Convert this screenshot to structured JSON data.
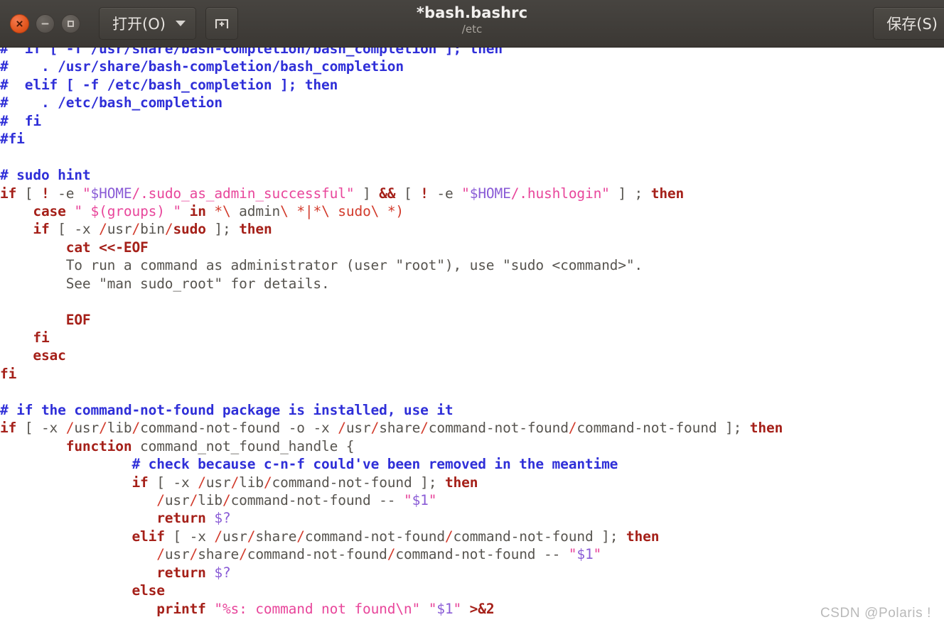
{
  "window": {
    "title": "*bash.bashrc",
    "subtitle": "/etc",
    "controls": {
      "close_label": "close-window",
      "minimize_label": "minimize-window",
      "maximize_label": "maximize-window"
    }
  },
  "toolbar": {
    "open_label": "打开(O)",
    "open_dropdown_label": "chevron-down-icon",
    "new_tab_label": "new-document-icon",
    "save_label": "保存(S)"
  },
  "watermark": "CSDN @Polaris !",
  "colors": {
    "titlebar_bg": "#413e3a",
    "close_button": "#e2571f",
    "editor_bg": "#ffffff",
    "comment": "#2f2fd8",
    "keyword": "#a52019",
    "string": "#e8469b",
    "variable": "#8a5cd6",
    "path_slash": "#d23b2c",
    "plain_text": "#57544f",
    "watermark": "#b9b9b9"
  },
  "editor": {
    "language": "sh",
    "filename": "bash.bashrc",
    "path": "/etc",
    "modified": true,
    "lines": [
      [
        {
          "t": "#  if [ -f /usr/share/bash-completion/bash_completion ]; then",
          "c": "cm"
        }
      ],
      [
        {
          "t": "#    . /usr/share/bash-completion/bash_completion",
          "c": "cm"
        }
      ],
      [
        {
          "t": "#  elif [ -f /etc/bash_completion ]; then",
          "c": "cm"
        }
      ],
      [
        {
          "t": "#    . /etc/bash_completion",
          "c": "cm"
        }
      ],
      [
        {
          "t": "#  fi",
          "c": "cm"
        }
      ],
      [
        {
          "t": "#fi",
          "c": "cm"
        }
      ],
      [
        {
          "t": "",
          "c": "pl"
        }
      ],
      [
        {
          "t": "# sudo hint",
          "c": "cm"
        }
      ],
      [
        {
          "t": "if",
          "c": "kw"
        },
        {
          "t": " [ ",
          "c": "pl"
        },
        {
          "t": "!",
          "c": "kw"
        },
        {
          "t": " -e ",
          "c": "pl"
        },
        {
          "t": "\"",
          "c": "st"
        },
        {
          "t": "$HOME",
          "c": "var"
        },
        {
          "t": "/.sudo_as_admin_successful\"",
          "c": "st"
        },
        {
          "t": " ] ",
          "c": "pl"
        },
        {
          "t": "&&",
          "c": "kw"
        },
        {
          "t": " [ ",
          "c": "pl"
        },
        {
          "t": "!",
          "c": "kw"
        },
        {
          "t": " -e ",
          "c": "pl"
        },
        {
          "t": "\"",
          "c": "st"
        },
        {
          "t": "$HOME",
          "c": "var"
        },
        {
          "t": "/.hushlogin\"",
          "c": "st"
        },
        {
          "t": " ] ; ",
          "c": "pl"
        },
        {
          "t": "then",
          "c": "kw"
        }
      ],
      [
        {
          "t": "    ",
          "c": "pl"
        },
        {
          "t": "case",
          "c": "kw"
        },
        {
          "t": " ",
          "c": "pl"
        },
        {
          "t": "\" ",
          "c": "st"
        },
        {
          "t": "$(groups)",
          "c": "st"
        },
        {
          "t": " \"",
          "c": "st"
        },
        {
          "t": " ",
          "c": "pl"
        },
        {
          "t": "in",
          "c": "kw"
        },
        {
          "t": " ",
          "c": "pl"
        },
        {
          "t": "*\\",
          "c": "sl"
        },
        {
          "t": " admin",
          "c": "pl"
        },
        {
          "t": "\\",
          "c": "sl"
        },
        {
          "t": " ",
          "c": "pl"
        },
        {
          "t": "*|*\\",
          "c": "sl"
        },
        {
          "t": " ",
          "c": "pl"
        },
        {
          "t": "sudo\\",
          "c": "sl"
        },
        {
          "t": " ",
          "c": "pl"
        },
        {
          "t": "*)",
          "c": "sl"
        }
      ],
      [
        {
          "t": "    ",
          "c": "pl"
        },
        {
          "t": "if",
          "c": "kw"
        },
        {
          "t": " [ -x ",
          "c": "pl"
        },
        {
          "t": "/",
          "c": "sl"
        },
        {
          "t": "usr",
          "c": "pl"
        },
        {
          "t": "/",
          "c": "sl"
        },
        {
          "t": "bin",
          "c": "pl"
        },
        {
          "t": "/",
          "c": "sl"
        },
        {
          "t": "sudo",
          "c": "kw"
        },
        {
          "t": " ]; ",
          "c": "pl"
        },
        {
          "t": "then",
          "c": "kw"
        }
      ],
      [
        {
          "t": "        ",
          "c": "pl"
        },
        {
          "t": "cat <<-EOF",
          "c": "kw"
        }
      ],
      [
        {
          "t": "        To run a command as administrator (user \"root\"), use \"sudo <command>\".",
          "c": "pl"
        }
      ],
      [
        {
          "t": "        See \"man sudo_root\" for details.",
          "c": "pl"
        }
      ],
      [
        {
          "t": "",
          "c": "pl"
        }
      ],
      [
        {
          "t": "        ",
          "c": "pl"
        },
        {
          "t": "EOF",
          "c": "kw"
        }
      ],
      [
        {
          "t": "    ",
          "c": "pl"
        },
        {
          "t": "fi",
          "c": "kw"
        }
      ],
      [
        {
          "t": "    ",
          "c": "pl"
        },
        {
          "t": "esac",
          "c": "kw"
        }
      ],
      [
        {
          "t": "fi",
          "c": "kw"
        }
      ],
      [
        {
          "t": "",
          "c": "pl"
        }
      ],
      [
        {
          "t": "# if the command-not-found package is installed, use it",
          "c": "cm"
        }
      ],
      [
        {
          "t": "if",
          "c": "kw"
        },
        {
          "t": " [ -x ",
          "c": "pl"
        },
        {
          "t": "/",
          "c": "sl"
        },
        {
          "t": "usr",
          "c": "pl"
        },
        {
          "t": "/",
          "c": "sl"
        },
        {
          "t": "lib",
          "c": "pl"
        },
        {
          "t": "/",
          "c": "sl"
        },
        {
          "t": "command-not-found",
          "c": "pl"
        },
        {
          "t": " -o -x ",
          "c": "pl"
        },
        {
          "t": "/",
          "c": "sl"
        },
        {
          "t": "usr",
          "c": "pl"
        },
        {
          "t": "/",
          "c": "sl"
        },
        {
          "t": "share",
          "c": "pl"
        },
        {
          "t": "/",
          "c": "sl"
        },
        {
          "t": "command-not-found",
          "c": "pl"
        },
        {
          "t": "/",
          "c": "sl"
        },
        {
          "t": "command-not-found",
          "c": "pl"
        },
        {
          "t": " ]; ",
          "c": "pl"
        },
        {
          "t": "then",
          "c": "kw"
        }
      ],
      [
        {
          "t": "        ",
          "c": "pl"
        },
        {
          "t": "function",
          "c": "kw"
        },
        {
          "t": " command_not_found_handle {",
          "c": "pl"
        }
      ],
      [
        {
          "t": "                ",
          "c": "pl"
        },
        {
          "t": "# check because c-n-f could've been removed in the meantime",
          "c": "cm"
        }
      ],
      [
        {
          "t": "                ",
          "c": "pl"
        },
        {
          "t": "if",
          "c": "kw"
        },
        {
          "t": " [ -x ",
          "c": "pl"
        },
        {
          "t": "/",
          "c": "sl"
        },
        {
          "t": "usr",
          "c": "pl"
        },
        {
          "t": "/",
          "c": "sl"
        },
        {
          "t": "lib",
          "c": "pl"
        },
        {
          "t": "/",
          "c": "sl"
        },
        {
          "t": "command-not-found",
          "c": "pl"
        },
        {
          "t": " ]; ",
          "c": "pl"
        },
        {
          "t": "then",
          "c": "kw"
        }
      ],
      [
        {
          "t": "                   ",
          "c": "pl"
        },
        {
          "t": "/",
          "c": "sl"
        },
        {
          "t": "usr",
          "c": "pl"
        },
        {
          "t": "/",
          "c": "sl"
        },
        {
          "t": "lib",
          "c": "pl"
        },
        {
          "t": "/",
          "c": "sl"
        },
        {
          "t": "command-not-found",
          "c": "pl"
        },
        {
          "t": " -- ",
          "c": "pl"
        },
        {
          "t": "\"",
          "c": "st"
        },
        {
          "t": "$1",
          "c": "var"
        },
        {
          "t": "\"",
          "c": "st"
        }
      ],
      [
        {
          "t": "                   ",
          "c": "pl"
        },
        {
          "t": "return",
          "c": "kw"
        },
        {
          "t": " ",
          "c": "pl"
        },
        {
          "t": "$?",
          "c": "var"
        }
      ],
      [
        {
          "t": "                ",
          "c": "pl"
        },
        {
          "t": "elif",
          "c": "kw"
        },
        {
          "t": " [ -x ",
          "c": "pl"
        },
        {
          "t": "/",
          "c": "sl"
        },
        {
          "t": "usr",
          "c": "pl"
        },
        {
          "t": "/",
          "c": "sl"
        },
        {
          "t": "share",
          "c": "pl"
        },
        {
          "t": "/",
          "c": "sl"
        },
        {
          "t": "command-not-found",
          "c": "pl"
        },
        {
          "t": "/",
          "c": "sl"
        },
        {
          "t": "command-not-found",
          "c": "pl"
        },
        {
          "t": " ]; ",
          "c": "pl"
        },
        {
          "t": "then",
          "c": "kw"
        }
      ],
      [
        {
          "t": "                   ",
          "c": "pl"
        },
        {
          "t": "/",
          "c": "sl"
        },
        {
          "t": "usr",
          "c": "pl"
        },
        {
          "t": "/",
          "c": "sl"
        },
        {
          "t": "share",
          "c": "pl"
        },
        {
          "t": "/",
          "c": "sl"
        },
        {
          "t": "command-not-found",
          "c": "pl"
        },
        {
          "t": "/",
          "c": "sl"
        },
        {
          "t": "command-not-found",
          "c": "pl"
        },
        {
          "t": " -- ",
          "c": "pl"
        },
        {
          "t": "\"",
          "c": "st"
        },
        {
          "t": "$1",
          "c": "var"
        },
        {
          "t": "\"",
          "c": "st"
        }
      ],
      [
        {
          "t": "                   ",
          "c": "pl"
        },
        {
          "t": "return",
          "c": "kw"
        },
        {
          "t": " ",
          "c": "pl"
        },
        {
          "t": "$?",
          "c": "var"
        }
      ],
      [
        {
          "t": "                ",
          "c": "pl"
        },
        {
          "t": "else",
          "c": "kw"
        }
      ],
      [
        {
          "t": "                   ",
          "c": "pl"
        },
        {
          "t": "printf",
          "c": "kw"
        },
        {
          "t": " ",
          "c": "pl"
        },
        {
          "t": "\"%s: command not found\\n\"",
          "c": "st"
        },
        {
          "t": " ",
          "c": "pl"
        },
        {
          "t": "\"",
          "c": "st"
        },
        {
          "t": "$1",
          "c": "var"
        },
        {
          "t": "\"",
          "c": "st"
        },
        {
          "t": " ",
          "c": "pl"
        },
        {
          "t": ">&2",
          "c": "kw"
        }
      ]
    ]
  }
}
